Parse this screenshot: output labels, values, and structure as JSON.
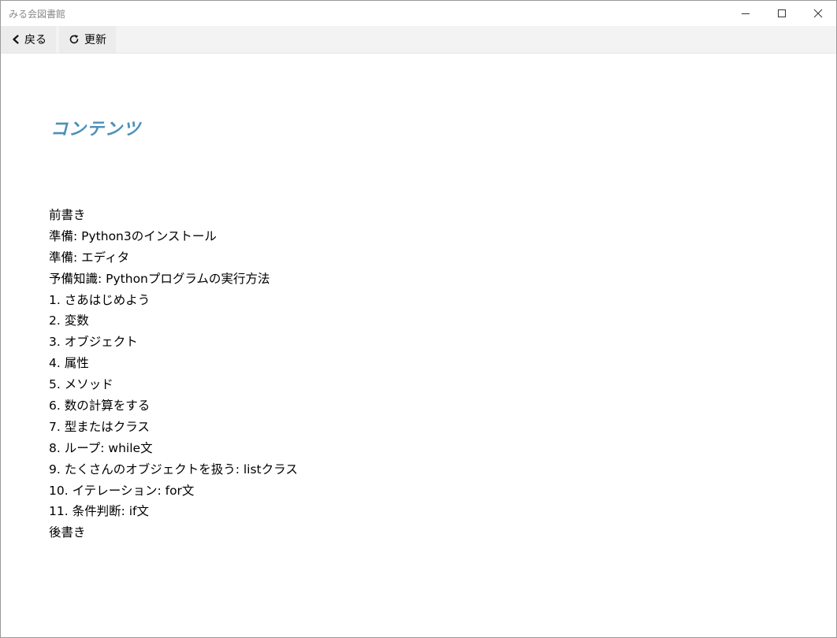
{
  "window": {
    "title": "みる会図書館"
  },
  "toolbar": {
    "back_label": "戻る",
    "refresh_label": "更新"
  },
  "content": {
    "heading": "コンテンツ",
    "items": [
      "前書き",
      "準備: Python3のインストール",
      "準備: エディタ",
      "予備知識: Pythonプログラムの実行方法",
      "1. さあはじめよう",
      "2. 変数",
      "3. オブジェクト",
      "4. 属性",
      "5. メソッド",
      "6. 数の計算をする",
      "7. 型またはクラス",
      "8. ループ: while文",
      "9. たくさんのオブジェクトを扱う: listクラス",
      "10. イテレーション: for文",
      "11. 条件判断: if文",
      "後書き"
    ]
  },
  "colors": {
    "heading": "#4b90b8",
    "toolbar_bg": "#f3f3f3",
    "title_text": "#8a8a8a"
  }
}
